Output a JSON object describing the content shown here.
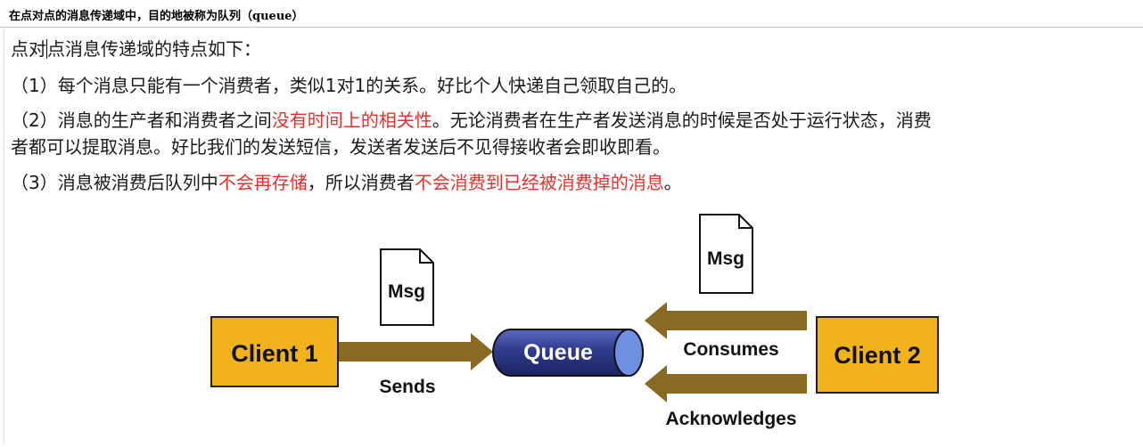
{
  "header": {
    "title": "在点对点的消息传递域中，目的地被称为队列（queue）"
  },
  "content": {
    "heading_pre": "点对",
    "heading_post": "点消息传递域的特点如下：",
    "item1": "（1）每个消息只能有一个消费者，类似1对1的关系。好比个人快递自己领取自己的。",
    "item2": {
      "pre": "（2）消息的生产者和消费者之间",
      "highlight": "没有时间上的相关性",
      "post": "。无论消费者在生产者发送消息的时候是否处于运行状态，消费",
      "line2": "者都可以提取消息。好比我们的发送短信，发送者发送后不见得接收者会即收即看。"
    },
    "item3": {
      "pre": "（3）消息被消费后队列中",
      "highlight1": "不会再存储",
      "mid": "，所以消费者",
      "highlight2": "不会消费到已经被消费掉的消息",
      "post": "。"
    }
  },
  "diagram": {
    "client1": "Client 1",
    "client2": "Client 2",
    "queue": "Queue",
    "msg1": "Msg",
    "msg2": "Msg",
    "sends": "Sends",
    "consumes": "Consumes",
    "acknowledges": "Acknowledges",
    "colors": {
      "client": "#f2b21b",
      "arrow": "#8a6a22",
      "queue": "#2f3b8c",
      "highlight": "#e8312c"
    }
  }
}
